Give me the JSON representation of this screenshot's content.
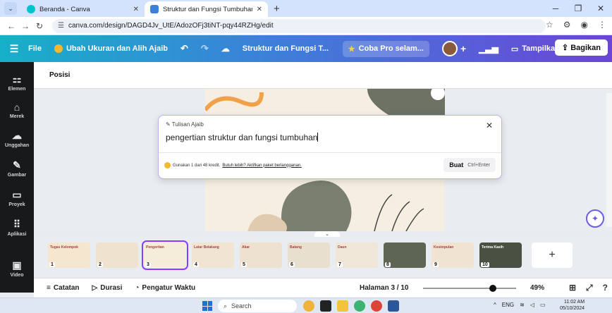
{
  "browser": {
    "tabs": [
      {
        "title": "Beranda - Canva",
        "active": false,
        "favicon_color": "#00c4cc"
      },
      {
        "title": "Struktur dan Fungsi Tumbuhan",
        "active": true,
        "favicon_color": "#3d7fd9"
      }
    ],
    "new_tab": "+",
    "url": "canva.com/design/DAGD4Jv_UtE/AdozOFj3tiNT-pqy44RZHg/edit"
  },
  "toolbar": {
    "file": "File",
    "magic_resize": "Ubah Ukuran dan Alih Ajaib",
    "doc_title": "Struktur dan Fungsi T...",
    "try_pro": "Coba Pro selam...",
    "present": "Tampilkan",
    "share": "Bagikan"
  },
  "sidebar": {
    "items": [
      {
        "label": "Elemen",
        "icon": "elements-icon"
      },
      {
        "label": "Merek",
        "icon": "brand-icon"
      },
      {
        "label": "Unggahan",
        "icon": "upload-icon"
      },
      {
        "label": "Gambar",
        "icon": "draw-icon"
      },
      {
        "label": "Proyek",
        "icon": "folder-icon"
      },
      {
        "label": "Aplikasi",
        "icon": "apps-icon"
      },
      {
        "label": "Video",
        "icon": "video-icon"
      }
    ]
  },
  "editor": {
    "position_label": "Posisi"
  },
  "magic_write": {
    "title": "Tulisan Ajaib",
    "input_value": "pengertian struktur dan fungsi tumbuhan",
    "credit_text": "Gunakan 1 dari 48 kredit.",
    "credit_link": "Butuh lebih? Aktifkan paket berlangganan.",
    "generate": "Buat",
    "shortcut": "Ctrl+Enter"
  },
  "pages": {
    "thumbnails": [
      {
        "num": "1",
        "text": "Tugas Kelompok",
        "bg": "#f4e6cf"
      },
      {
        "num": "2",
        "text": "",
        "bg": "#efe3d0"
      },
      {
        "num": "3",
        "text": "Pengertian",
        "bg": "#f5ecd9"
      },
      {
        "num": "4",
        "text": "Latar Belakang",
        "bg": "#f1e4d2"
      },
      {
        "num": "5",
        "text": "Akar",
        "bg": "#efe1cf"
      },
      {
        "num": "6",
        "text": "Batang",
        "bg": "#e9dfcf"
      },
      {
        "num": "7",
        "text": "Daun",
        "bg": "#f0e6d7"
      },
      {
        "num": "8",
        "text": "",
        "bg": "#5e6553"
      },
      {
        "num": "9",
        "text": "Kesimpulan",
        "bg": "#f0e3d1"
      },
      {
        "num": "10",
        "text": "Terima Kasih",
        "bg": "#4a5142"
      }
    ],
    "selected_index": 2,
    "add": "+"
  },
  "status": {
    "notes": "Catatan",
    "duration": "Durasi",
    "timer": "Pengatur Waktu",
    "page_count": "Halaman 3 / 10",
    "zoom": "49%",
    "zoom_fraction": 0.49
  },
  "taskbar": {
    "search": "Search",
    "lang": "ENG",
    "time": "11:02 AM",
    "date": "05/10/2024"
  }
}
